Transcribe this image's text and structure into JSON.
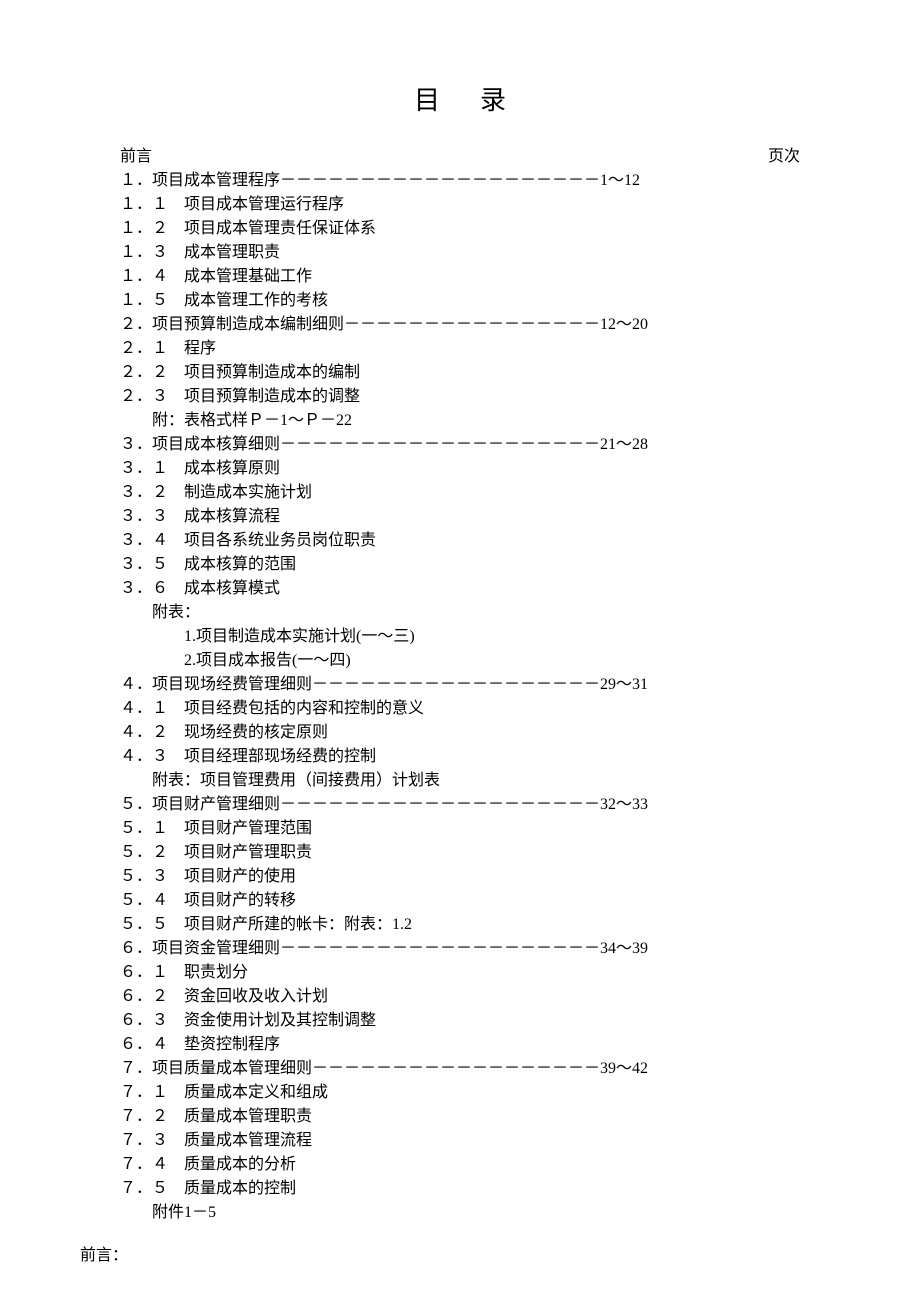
{
  "title": "目录",
  "header_left": "前言",
  "header_right": "页次",
  "footer": "前言：",
  "items": [
    {
      "text": "１．项目成本管理程序－－－－－－－－－－－－－－－－－－－－1～12",
      "indent": 0
    },
    {
      "text": "１．１　项目成本管理运行程序",
      "indent": 0
    },
    {
      "text": "１．２　项目成本管理责任保证体系",
      "indent": 0
    },
    {
      "text": "１．３　成本管理职责",
      "indent": 0
    },
    {
      "text": "１．４　成本管理基础工作",
      "indent": 0
    },
    {
      "text": "１．５　成本管理工作的考核",
      "indent": 0
    },
    {
      "text": "２．项目预算制造成本编制细则－－－－－－－－－－－－－－－－12～20",
      "indent": 0
    },
    {
      "text": "２．１　程序",
      "indent": 0
    },
    {
      "text": "２．２　项目预算制造成本的编制",
      "indent": 0
    },
    {
      "text": "２．３　项目预算制造成本的调整",
      "indent": 0
    },
    {
      "text": "附：表格式样Ｐ－1～Ｐ－22",
      "indent": 1
    },
    {
      "text": "３．项目成本核算细则－－－－－－－－－－－－－－－－－－－－21～28",
      "indent": 0
    },
    {
      "text": "３．１　成本核算原则",
      "indent": 0
    },
    {
      "text": "３．２　制造成本实施计划",
      "indent": 0
    },
    {
      "text": "３．３　成本核算流程",
      "indent": 0
    },
    {
      "text": "３．４　项目各系统业务员岗位职责",
      "indent": 0
    },
    {
      "text": "３．５　成本核算的范围",
      "indent": 0
    },
    {
      "text": "３．６　成本核算模式",
      "indent": 0
    },
    {
      "text": "附表：",
      "indent": 1
    },
    {
      "text": "1.项目制造成本实施计划(一～三)",
      "indent": 2
    },
    {
      "text": "2.项目成本报告(一～四)",
      "indent": 2
    },
    {
      "text": "４．项目现场经费管理细则－－－－－－－－－－－－－－－－－－29～31",
      "indent": 0
    },
    {
      "text": "４．１　项目经费包括的内容和控制的意义",
      "indent": 0
    },
    {
      "text": "４．２　现场经费的核定原则",
      "indent": 0
    },
    {
      "text": "４．３　项目经理部现场经费的控制",
      "indent": 0
    },
    {
      "text": "附表：项目管理费用（间接费用）计划表",
      "indent": 1
    },
    {
      "text": "５．项目财产管理细则－－－－－－－－－－－－－－－－－－－－32～33",
      "indent": 0
    },
    {
      "text": "５．１　项目财产管理范围",
      "indent": 0
    },
    {
      "text": "５．２　项目财产管理职责",
      "indent": 0
    },
    {
      "text": "５．３　项目财产的使用",
      "indent": 0
    },
    {
      "text": "５．４　项目财产的转移",
      "indent": 0
    },
    {
      "text": "５．５　项目财产所建的帐卡：附表：1.2",
      "indent": 0
    },
    {
      "text": "６．项目资金管理细则－－－－－－－－－－－－－－－－－－－－34～39",
      "indent": 0
    },
    {
      "text": "６．１　职责划分",
      "indent": 0
    },
    {
      "text": "６．２　资金回收及收入计划",
      "indent": 0
    },
    {
      "text": "６．３　资金使用计划及其控制调整",
      "indent": 0
    },
    {
      "text": "６．４　垫资控制程序",
      "indent": 0
    },
    {
      "text": "７．项目质量成本管理细则－－－－－－－－－－－－－－－－－－39～42",
      "indent": 0
    },
    {
      "text": "７．１　质量成本定义和组成",
      "indent": 0
    },
    {
      "text": "７．２　质量成本管理职责",
      "indent": 0
    },
    {
      "text": "７．３　质量成本管理流程",
      "indent": 0
    },
    {
      "text": "７．４　质量成本的分析",
      "indent": 0
    },
    {
      "text": "７．５　质量成本的控制",
      "indent": 0
    },
    {
      "text": "附件1－5",
      "indent": 1
    }
  ]
}
